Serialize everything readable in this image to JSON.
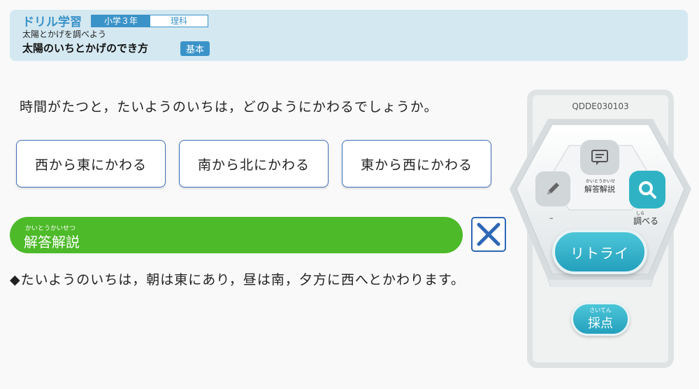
{
  "header": {
    "app_name": "ドリル学習",
    "grade": "小学３年",
    "subject": "理科",
    "unit": "太陽とかげを調べよう",
    "lesson": "太陽のいちとかげのでき方",
    "level": "基本"
  },
  "question": {
    "text": "時間がたつと，たいようのいちは，どのようにかわるでしょうか。",
    "choices": [
      "西から東にかわる",
      "南から北にかわる",
      "東から西にかわる"
    ]
  },
  "explanation": {
    "ruby": "かいとうかいせつ",
    "label": "解答解説",
    "answer_text": "◆たいようのいちは，朝は東にあり，昼は南，夕方に西へとかわります。"
  },
  "panel": {
    "code": "QDDE030103",
    "note_ruby": "かいとうかいせつ",
    "note_label": "解答解説",
    "pencil_label": "–",
    "search_ruby": "しら",
    "search_label": "調べる",
    "retry_label": "リトライ",
    "score_ruby": "さいてん",
    "score_label": "採点"
  },
  "colors": {
    "accent_blue": "#3a93c8",
    "green_bar": "#4dba29",
    "teal_button": "#2fb3c4",
    "close_x": "#2e68b5"
  },
  "icons": {
    "note": "note-icon",
    "pencil": "pencil-icon",
    "search": "search-icon",
    "close": "close-icon"
  }
}
